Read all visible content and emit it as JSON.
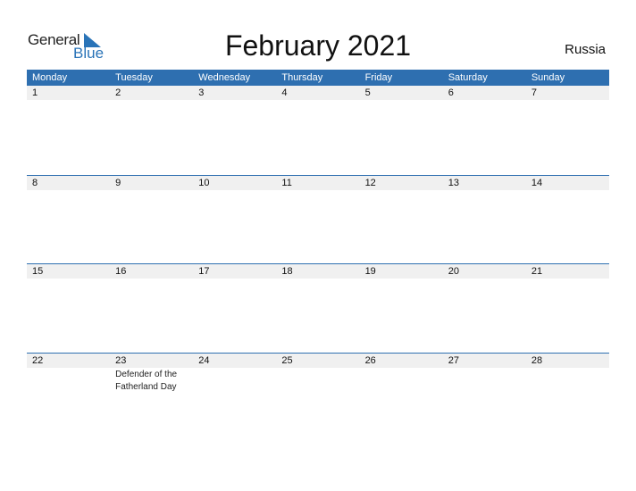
{
  "logo": {
    "text_general": "General",
    "text_blue": "Blue"
  },
  "title": "February 2021",
  "country": "Russia",
  "weekdays": [
    "Monday",
    "Tuesday",
    "Wednesday",
    "Thursday",
    "Friday",
    "Saturday",
    "Sunday"
  ],
  "weeks": [
    {
      "days": [
        {
          "d": "1"
        },
        {
          "d": "2"
        },
        {
          "d": "3"
        },
        {
          "d": "4"
        },
        {
          "d": "5"
        },
        {
          "d": "6"
        },
        {
          "d": "7"
        }
      ]
    },
    {
      "days": [
        {
          "d": "8"
        },
        {
          "d": "9"
        },
        {
          "d": "10"
        },
        {
          "d": "11"
        },
        {
          "d": "12"
        },
        {
          "d": "13"
        },
        {
          "d": "14"
        }
      ]
    },
    {
      "days": [
        {
          "d": "15"
        },
        {
          "d": "16"
        },
        {
          "d": "17"
        },
        {
          "d": "18"
        },
        {
          "d": "19"
        },
        {
          "d": "20"
        },
        {
          "d": "21"
        }
      ]
    },
    {
      "days": [
        {
          "d": "22"
        },
        {
          "d": "23",
          "event": "Defender of the\nFatherland Day"
        },
        {
          "d": "24"
        },
        {
          "d": "25"
        },
        {
          "d": "26"
        },
        {
          "d": "27"
        },
        {
          "d": "28"
        }
      ]
    }
  ],
  "colors": {
    "header_bg": "#2e6fb0",
    "accent": "#2a74b8",
    "strip_bg": "#f0f0f0"
  }
}
